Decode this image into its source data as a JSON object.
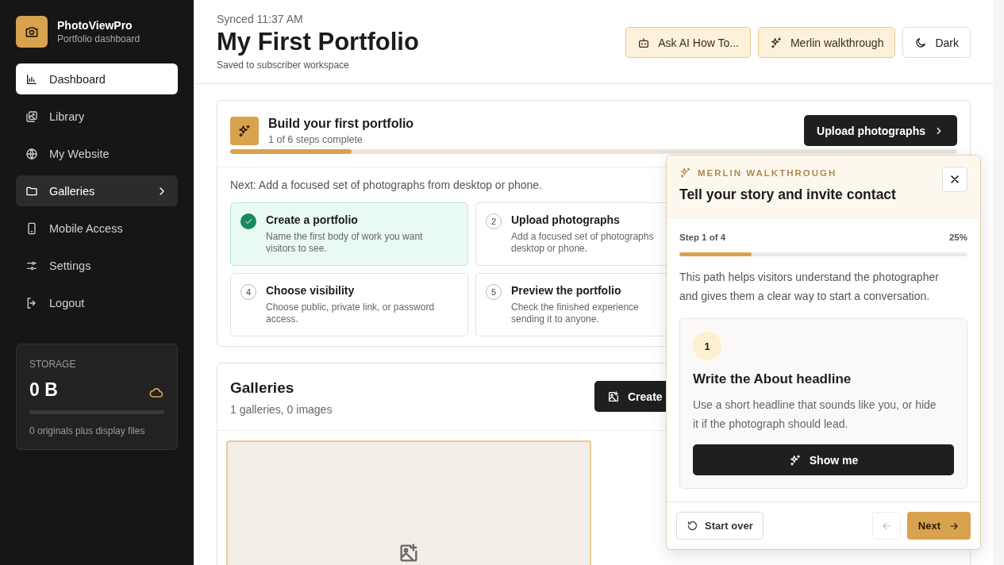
{
  "brand": {
    "name": "PhotoViewPro",
    "subtitle": "Portfolio dashboard"
  },
  "nav": {
    "items": [
      {
        "label": "Dashboard",
        "selected": true,
        "hovered": false,
        "has_submenu": false
      },
      {
        "label": "Library",
        "selected": false,
        "hovered": false,
        "has_submenu": false
      },
      {
        "label": "My Website",
        "selected": false,
        "hovered": false,
        "has_submenu": false
      },
      {
        "label": "Galleries",
        "selected": false,
        "hovered": true,
        "has_submenu": true
      },
      {
        "label": "Mobile Access",
        "selected": false,
        "hovered": false,
        "has_submenu": false
      },
      {
        "label": "Settings",
        "selected": false,
        "hovered": false,
        "has_submenu": false
      },
      {
        "label": "Logout",
        "selected": false,
        "hovered": false,
        "has_submenu": false
      }
    ]
  },
  "storage": {
    "label": "STORAGE",
    "value": "0 B",
    "level": 0,
    "note": "0 originals plus display files"
  },
  "header": {
    "synced": "Synced 11:37 AM",
    "title": "My First Portfolio",
    "subtitle": "Saved to subscriber workspace",
    "buttons": [
      {
        "label": "Ask AI How To...",
        "kind": "bot"
      },
      {
        "label": "Merlin walkthrough",
        "kind": "sparkle"
      },
      {
        "label": "Dark",
        "kind": "moon"
      }
    ]
  },
  "onboarding": {
    "title": "Build your first portfolio",
    "progress_text": "1 of 6 steps complete",
    "level": 0.167,
    "button": "Upload photographs",
    "next": "Next: Add a focused set of photographs from desktop or phone.",
    "steps": [
      {
        "done": true,
        "title": "Create a portfolio",
        "lines": [
          "Name the first body of work you want",
          "visitors to see."
        ]
      },
      {
        "number": "2",
        "done": false,
        "title": "Upload photographs",
        "lines": [
          "Add a focused set of photographs",
          "desktop or phone."
        ]
      },
      {
        "number": "4",
        "done": false,
        "title": "Choose visibility",
        "lines": [
          "Choose public, private link, or password",
          "access."
        ]
      },
      {
        "number": "5",
        "done": false,
        "title": "Preview the portfolio",
        "lines": [
          "Check the finished experience",
          "sending it to anyone."
        ]
      }
    ]
  },
  "galleries": {
    "title": "Galleries",
    "subtitle": "1 galleries, 0 images",
    "button": "Create"
  },
  "walkthrough": {
    "label": "MERLIN WALKTHROUGH",
    "title": "Tell your story and invite contact",
    "step": "Step 1 of 4",
    "percent": "25%",
    "level": 0.25,
    "description": "This path helps visitors understand the photographer and gives them a clear way to start a conversation.",
    "task": {
      "number": "1",
      "title": "Write the About headline",
      "text": "Use a short headline that sounds like you, or hide it if the photograph should lead.",
      "button": "Show me"
    },
    "start_over": "Start over",
    "back_disabled": true,
    "next": "Next"
  }
}
